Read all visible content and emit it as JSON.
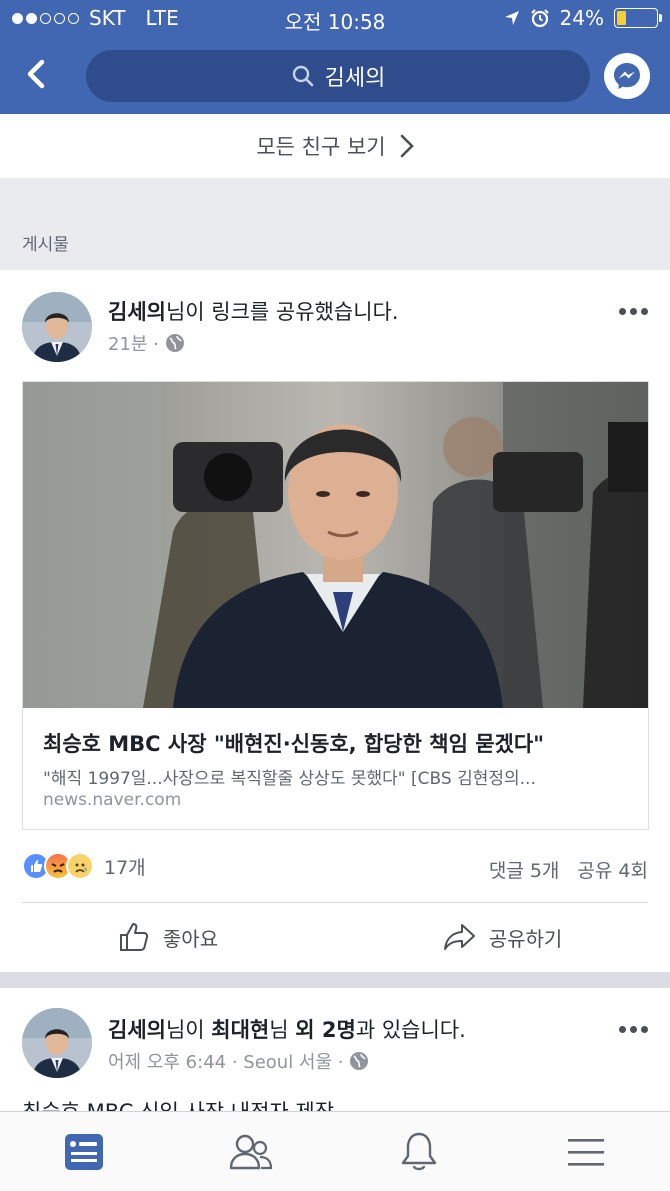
{
  "status_bar": {
    "carrier": "SKT",
    "network": "LTE",
    "time": "오전 10:58",
    "battery": "24%"
  },
  "nav": {
    "search_text": "김세의",
    "icons": [
      "back-chevron-icon",
      "search-icon",
      "messenger-icon"
    ]
  },
  "friends": {
    "see_all_label": "모든 친구 보기"
  },
  "posts_section": {
    "label": "게시물"
  },
  "post1": {
    "author": "김세의",
    "action_text": "님이 링크를 공유했습니다.",
    "time": "21분 ·",
    "link": {
      "title": "최승호 MBC 사장 \"배현진·신동호, 합당한 책임 묻겠다\"",
      "description": "\"해직 1997일...사장으로 복직할줄 상상도 못했다\" [CBS 김현정의...",
      "domain": "news.naver.com"
    },
    "reaction_count": "17개",
    "comments": "댓글 5개",
    "shares": "공유 4회",
    "like_label": "좋아요",
    "share_label": "공유하기"
  },
  "post2": {
    "author": "김세의",
    "mid1": "님이 ",
    "tagged": "최대현",
    "mid2": "님 ",
    "others": "외 2명",
    "end": "과 있습니다.",
    "time": "어제 오후 6:44 · Seoul 서울 ·",
    "text_preview": "최승호 MBC 신임 사장 내정자 제작"
  },
  "tabbar": {
    "tabs": [
      "news-feed-icon",
      "friends-icon",
      "notifications-icon",
      "menu-icon"
    ],
    "active_color": "#4267b2"
  }
}
